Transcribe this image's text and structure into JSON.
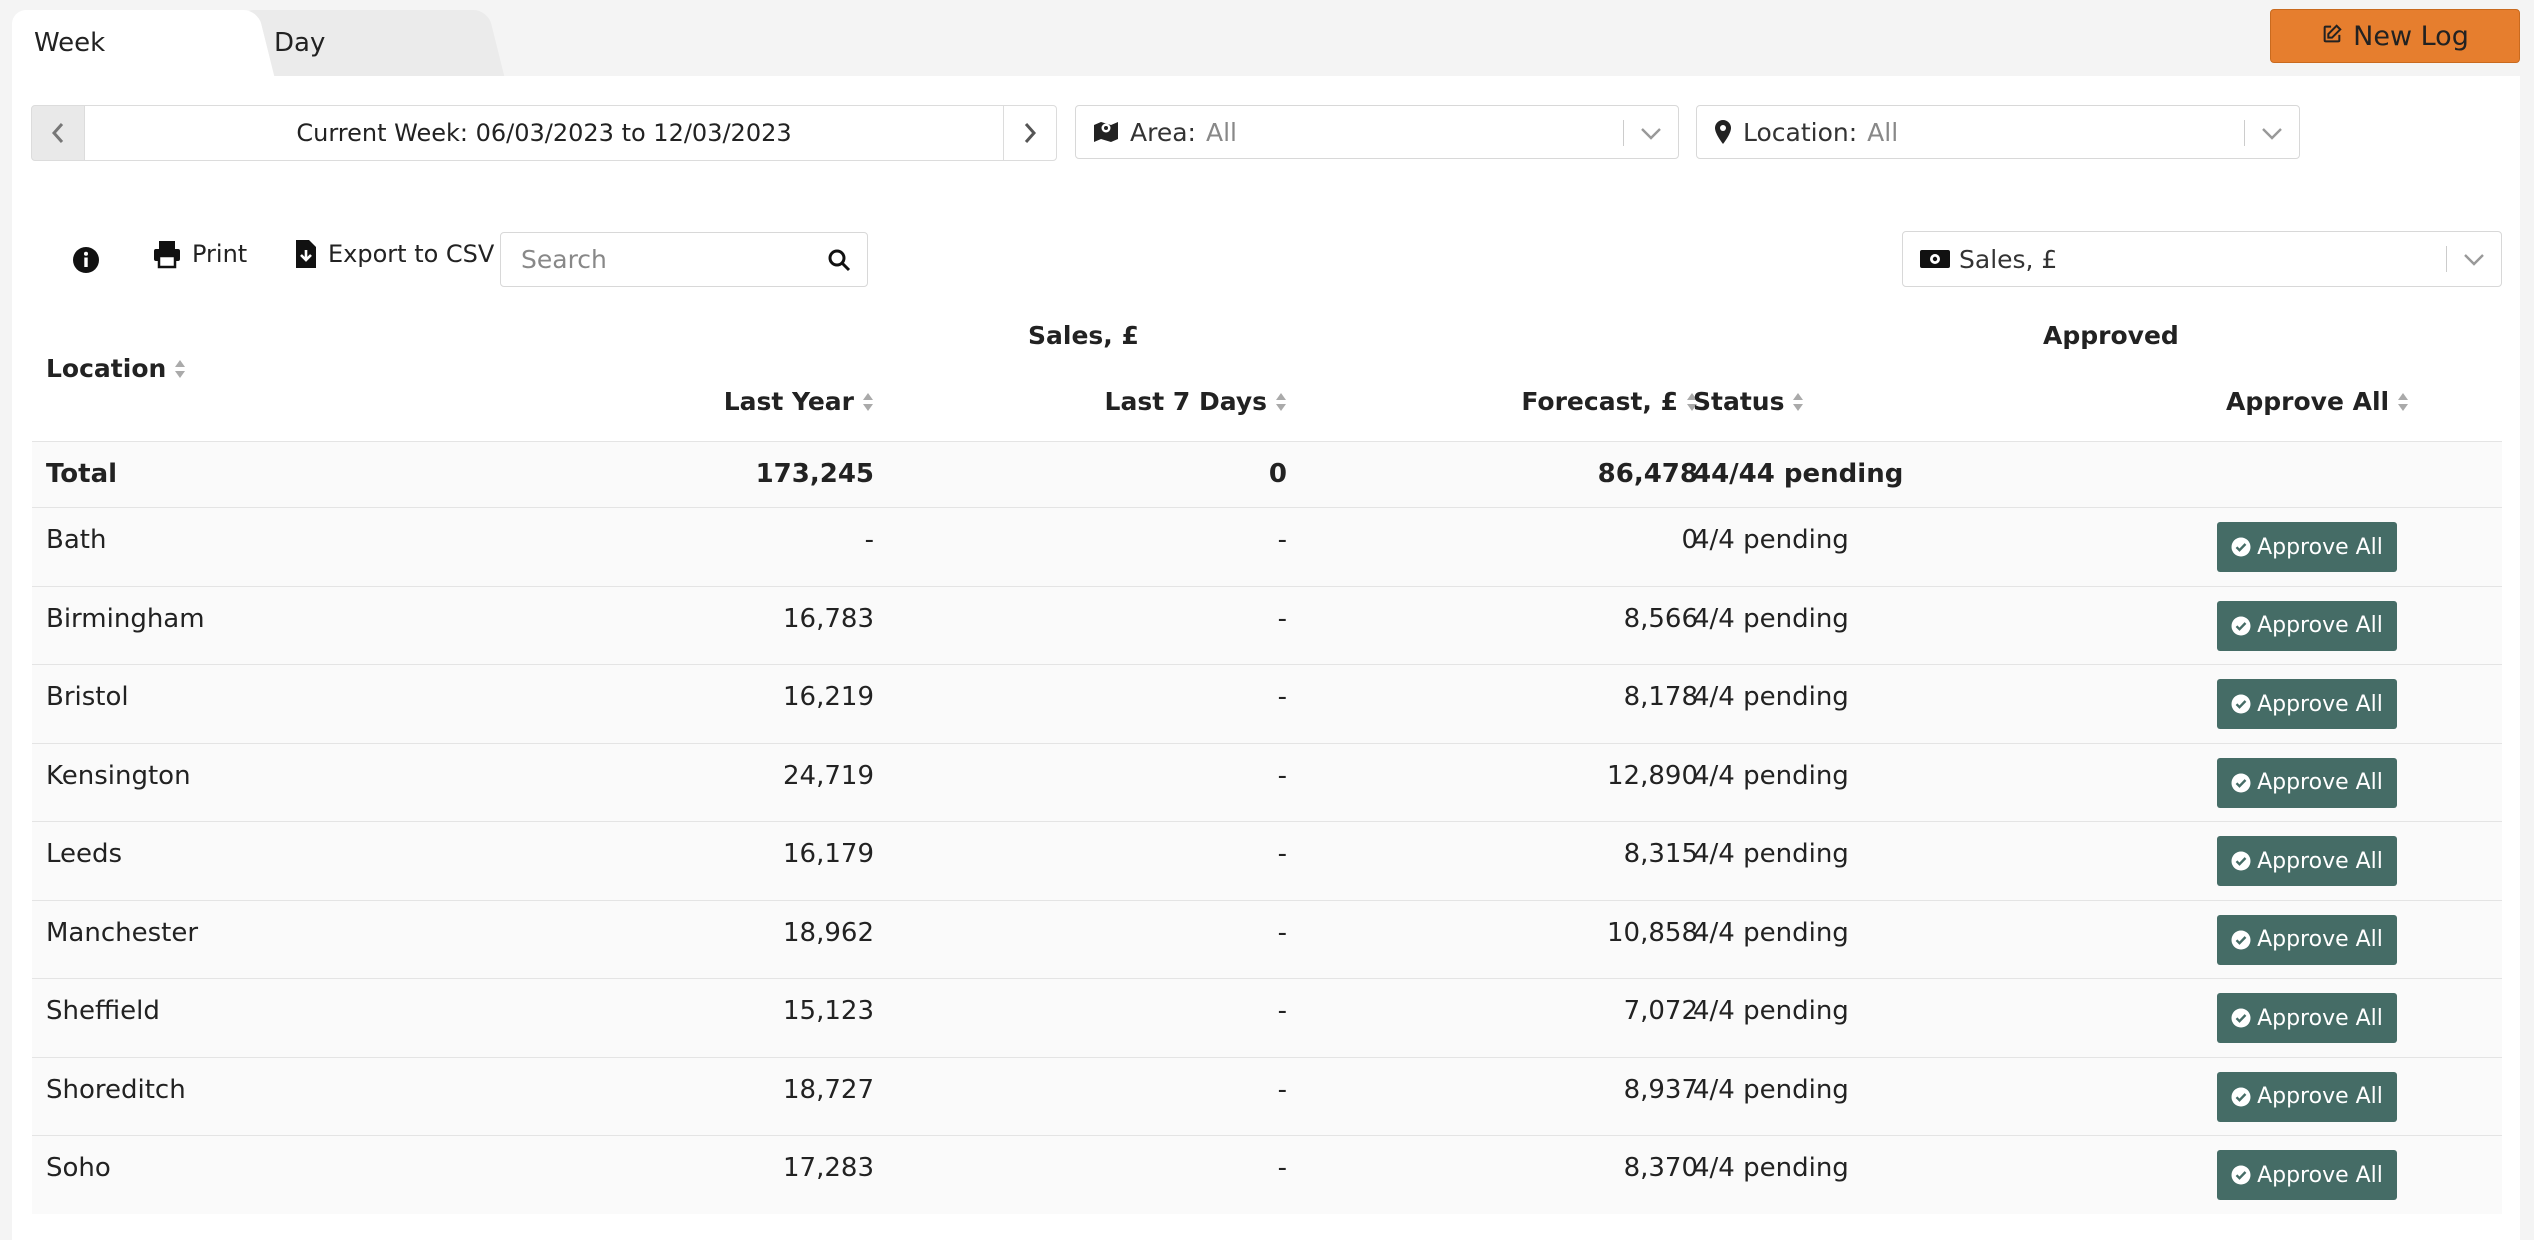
{
  "tabs": [
    {
      "label": "Week"
    },
    {
      "label": "Day"
    }
  ],
  "new_log_label": "New Log",
  "week_nav": {
    "label": "Current Week: 06/03/2023 to 12/03/2023"
  },
  "filters": {
    "area": {
      "label": "Area:",
      "value": "All"
    },
    "location": {
      "label": "Location:",
      "value": "All"
    },
    "metric": {
      "value": "Sales, £"
    }
  },
  "toolbar": {
    "print_label": "Print",
    "export_label": "Export to CSV",
    "search_placeholder": "Search"
  },
  "table": {
    "group_sales": "Sales, £",
    "group_approved": "Approved",
    "headers": {
      "location": "Location",
      "last_year": "Last Year",
      "last_7_days": "Last 7 Days",
      "forecast": "Forecast, £",
      "status": "Status",
      "approve_all": "Approve All"
    },
    "total": {
      "location": "Total",
      "last_year": "173,245",
      "last_7_days": "0",
      "forecast": "86,478",
      "status": "44/44 pending"
    },
    "approve_button_label": "Approve All",
    "rows": [
      {
        "location": "Bath",
        "last_year": "-",
        "last_7_days": "-",
        "forecast": "0",
        "status": "4/4 pending"
      },
      {
        "location": "Birmingham",
        "last_year": "16,783",
        "last_7_days": "-",
        "forecast": "8,566",
        "status": "4/4 pending"
      },
      {
        "location": "Bristol",
        "last_year": "16,219",
        "last_7_days": "-",
        "forecast": "8,178",
        "status": "4/4 pending"
      },
      {
        "location": "Kensington",
        "last_year": "24,719",
        "last_7_days": "-",
        "forecast": "12,890",
        "status": "4/4 pending"
      },
      {
        "location": "Leeds",
        "last_year": "16,179",
        "last_7_days": "-",
        "forecast": "8,315",
        "status": "4/4 pending"
      },
      {
        "location": "Manchester",
        "last_year": "18,962",
        "last_7_days": "-",
        "forecast": "10,858",
        "status": "4/4 pending"
      },
      {
        "location": "Sheffield",
        "last_year": "15,123",
        "last_7_days": "-",
        "forecast": "7,072",
        "status": "4/4 pending"
      },
      {
        "location": "Shoreditch",
        "last_year": "18,727",
        "last_7_days": "-",
        "forecast": "8,937",
        "status": "4/4 pending"
      },
      {
        "location": "Soho",
        "last_year": "17,283",
        "last_7_days": "-",
        "forecast": "8,370",
        "status": "4/4 pending"
      }
    ]
  },
  "colors": {
    "accent": "#e67e2e",
    "approve": "#456c66"
  },
  "icons": [
    "edit-icon",
    "chevron-left-icon",
    "chevron-right-icon",
    "map-icon",
    "map-marker-icon",
    "chevron-down-icon",
    "info-icon",
    "print-icon",
    "file-download-icon",
    "search-icon",
    "money-icon",
    "sort-icon",
    "check-circle-icon"
  ]
}
